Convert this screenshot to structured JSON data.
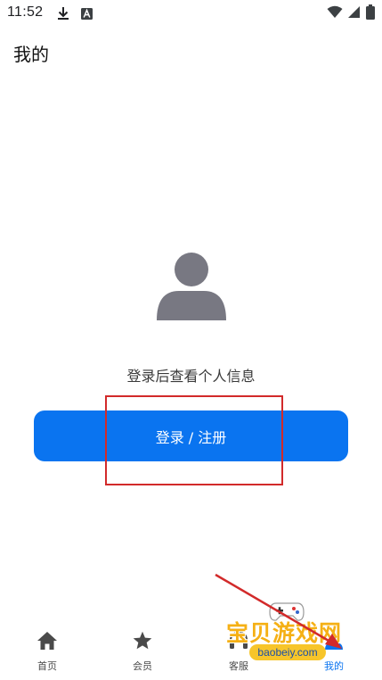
{
  "status_bar": {
    "time": "11:52",
    "icons": [
      "download-icon",
      "a-badge-icon",
      "wifi-icon",
      "signal-icon",
      "battery-icon"
    ]
  },
  "header": {
    "title": "我的"
  },
  "profile": {
    "avatar_icon": "user-avatar-icon",
    "prompt": "登录后查看个人信息",
    "login_button_label": "登录 / 注册"
  },
  "bottom_nav": {
    "items": [
      {
        "label": "首页",
        "icon": "home-icon"
      },
      {
        "label": "会员",
        "icon": "star-icon"
      },
      {
        "label": "客服",
        "icon": "headset-icon"
      },
      {
        "label": "我的",
        "icon": "person-icon"
      }
    ],
    "active_index": 3
  },
  "watermark": {
    "text": "宝贝游戏网",
    "url": "baobeiy.com"
  },
  "colors": {
    "accent": "#0a74f0",
    "annotation_red": "#d22a2a",
    "icon_gray": "#7a7a84",
    "watermark_yellow": "#f5b015"
  }
}
